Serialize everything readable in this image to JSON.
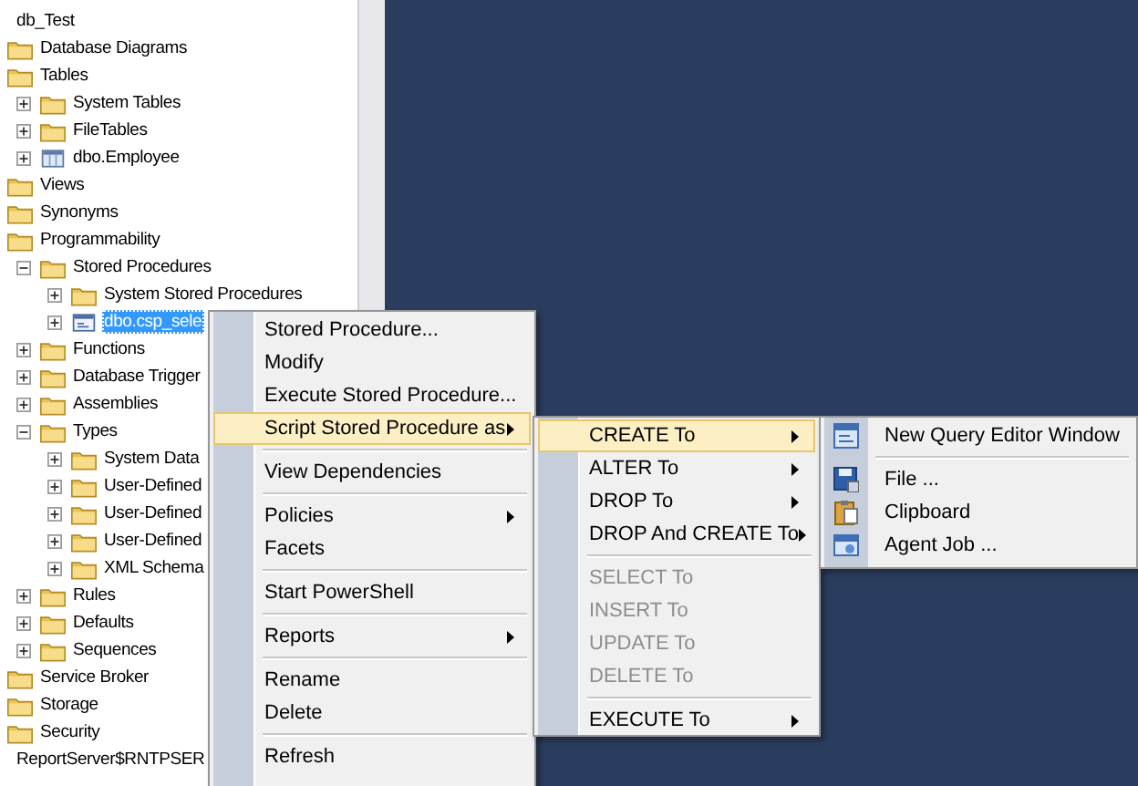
{
  "tree": [
    {
      "label": "db_Test",
      "kind": "text",
      "selected": false
    },
    {
      "label": "Database Diagrams",
      "kind": "folder",
      "selected": false
    },
    {
      "label": "Tables",
      "kind": "folder",
      "selected": false,
      "children": [
        {
          "label": "System Tables",
          "kind": "folder",
          "expanded": false,
          "selected": false
        },
        {
          "label": "FileTables",
          "kind": "folder",
          "expanded": false,
          "selected": false
        },
        {
          "label": "dbo.Employee",
          "kind": "table",
          "expanded": false,
          "selected": false
        }
      ]
    },
    {
      "label": "Views",
      "kind": "folder",
      "selected": false
    },
    {
      "label": "Synonyms",
      "kind": "folder",
      "selected": false
    },
    {
      "label": "Programmability",
      "kind": "folder",
      "selected": false,
      "children": [
        {
          "label": "Stored Procedures",
          "kind": "folder",
          "expanded": true,
          "selected": false,
          "children": [
            {
              "label": "System Stored Procedures",
              "kind": "folder",
              "expanded": false,
              "selected": false
            },
            {
              "label": "dbo.csp_sele",
              "kind": "procedure",
              "expanded": false,
              "selected": true
            }
          ]
        },
        {
          "label": "Functions",
          "kind": "folder",
          "expanded": false,
          "selected": false
        },
        {
          "label": "Database Trigger",
          "kind": "folder",
          "expanded": false,
          "selected": false
        },
        {
          "label": "Assemblies",
          "kind": "folder",
          "expanded": false,
          "selected": false
        },
        {
          "label": "Types",
          "kind": "folder",
          "expanded": true,
          "selected": false,
          "children": [
            {
              "label": "System Data",
              "kind": "folder",
              "expanded": false,
              "selected": false
            },
            {
              "label": "User-Defined",
              "kind": "folder",
              "expanded": false,
              "selected": false
            },
            {
              "label": "User-Defined",
              "kind": "folder",
              "expanded": false,
              "selected": false
            },
            {
              "label": "User-Defined",
              "kind": "folder",
              "expanded": false,
              "selected": false
            },
            {
              "label": "XML Schema",
              "kind": "folder",
              "expanded": false,
              "selected": false
            }
          ]
        },
        {
          "label": "Rules",
          "kind": "folder",
          "expanded": false,
          "selected": false
        },
        {
          "label": "Defaults",
          "kind": "folder",
          "expanded": false,
          "selected": false
        },
        {
          "label": "Sequences",
          "kind": "folder",
          "expanded": false,
          "selected": false
        }
      ]
    },
    {
      "label": "Service Broker",
      "kind": "folder",
      "selected": false
    },
    {
      "label": "Storage",
      "kind": "folder",
      "selected": false
    },
    {
      "label": "Security",
      "kind": "folder",
      "selected": false
    },
    {
      "label": "ReportServer$RNTPSER",
      "kind": "text",
      "selected": false
    }
  ],
  "context_menu": [
    {
      "kind": "item",
      "label": "Stored Procedure...",
      "submenu": false,
      "selected": false
    },
    {
      "kind": "item",
      "label": "Modify",
      "submenu": false,
      "selected": false
    },
    {
      "kind": "item",
      "label": "Execute Stored Procedure...",
      "submenu": false,
      "selected": false
    },
    {
      "kind": "item",
      "label": "Script Stored Procedure as",
      "submenu": true,
      "selected": true
    },
    {
      "kind": "separator"
    },
    {
      "kind": "item",
      "label": "View Dependencies",
      "submenu": false,
      "selected": false
    },
    {
      "kind": "separator"
    },
    {
      "kind": "item",
      "label": "Policies",
      "submenu": true,
      "selected": false
    },
    {
      "kind": "item",
      "label": "Facets",
      "submenu": false,
      "selected": false
    },
    {
      "kind": "separator"
    },
    {
      "kind": "item",
      "label": "Start PowerShell",
      "submenu": false,
      "selected": false
    },
    {
      "kind": "separator"
    },
    {
      "kind": "item",
      "label": "Reports",
      "submenu": true,
      "selected": false
    },
    {
      "kind": "separator"
    },
    {
      "kind": "item",
      "label": "Rename",
      "submenu": false,
      "selected": false
    },
    {
      "kind": "item",
      "label": "Delete",
      "submenu": false,
      "selected": false
    },
    {
      "kind": "separator"
    },
    {
      "kind": "item",
      "label": "Refresh",
      "submenu": false,
      "selected": false
    }
  ],
  "script_submenu": [
    {
      "kind": "item",
      "label": "CREATE To",
      "submenu": true,
      "selected": true,
      "disabled": false
    },
    {
      "kind": "item",
      "label": "ALTER To",
      "submenu": true,
      "selected": false,
      "disabled": false
    },
    {
      "kind": "item",
      "label": "DROP To",
      "submenu": true,
      "selected": false,
      "disabled": false
    },
    {
      "kind": "item",
      "label": "DROP And CREATE To",
      "submenu": true,
      "selected": false,
      "disabled": false
    },
    {
      "kind": "separator"
    },
    {
      "kind": "item",
      "label": "SELECT To",
      "submenu": false,
      "selected": false,
      "disabled": true
    },
    {
      "kind": "item",
      "label": "INSERT To",
      "submenu": false,
      "selected": false,
      "disabled": true
    },
    {
      "kind": "item",
      "label": "UPDATE To",
      "submenu": false,
      "selected": false,
      "disabled": true
    },
    {
      "kind": "item",
      "label": "DELETE To",
      "submenu": false,
      "selected": false,
      "disabled": true
    },
    {
      "kind": "separator"
    },
    {
      "kind": "item",
      "label": "EXECUTE To",
      "submenu": true,
      "selected": false,
      "disabled": false
    }
  ],
  "create_submenu": [
    {
      "kind": "query",
      "label": "New Query Editor Window"
    },
    {
      "kind": "separator"
    },
    {
      "kind": "file",
      "label": "File ..."
    },
    {
      "kind": "clipboard",
      "label": "Clipboard"
    },
    {
      "kind": "job",
      "label": "Agent Job ..."
    }
  ]
}
